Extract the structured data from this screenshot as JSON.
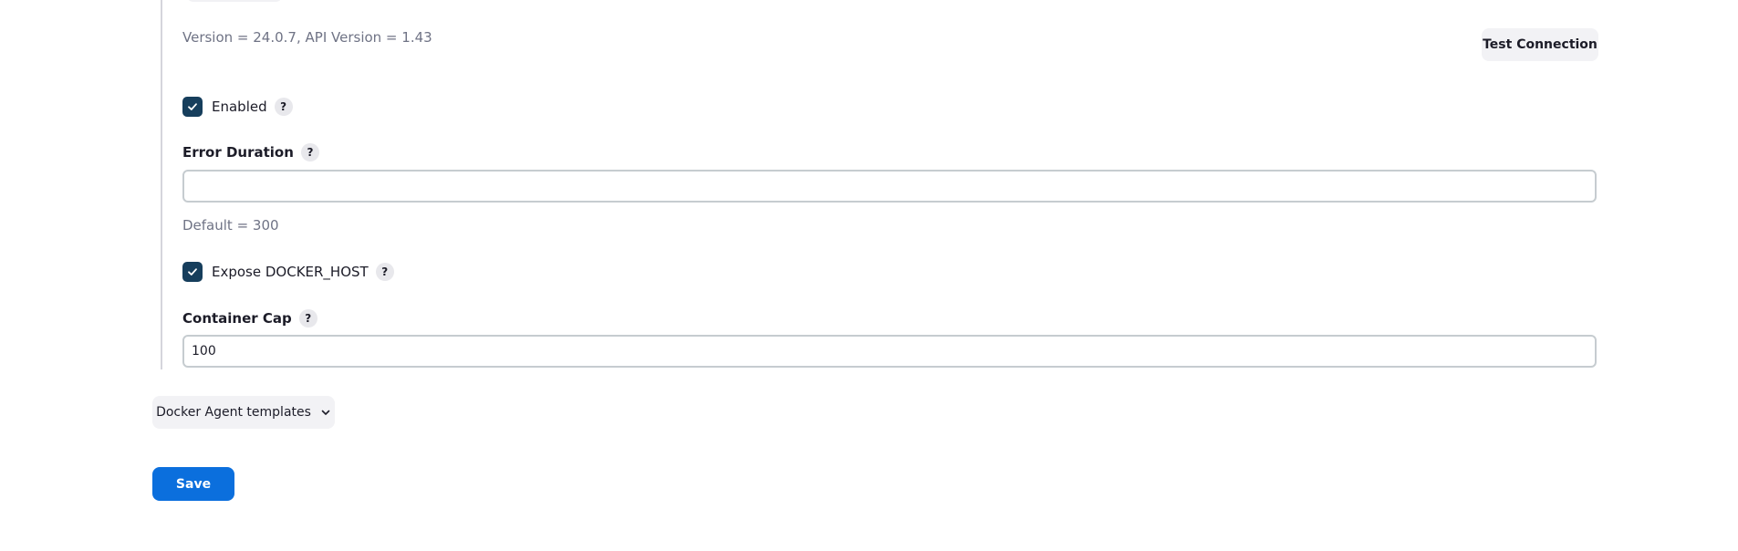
{
  "cloud_config": {
    "version_info": "Version = 24.0.7, API Version = 1.43",
    "test_connection_label": "Test Connection",
    "enabled": {
      "label": "Enabled",
      "checked": true,
      "help": "?"
    },
    "error_duration": {
      "label": "Error Duration",
      "help": "?",
      "value": "",
      "default_hint": "Default = 300"
    },
    "expose_docker_host": {
      "label": "Expose DOCKER_HOST",
      "checked": true,
      "help": "?"
    },
    "container_cap": {
      "label": "Container Cap",
      "help": "?",
      "value": "100"
    }
  },
  "agent_templates": {
    "label": "Docker Agent templates",
    "icon": "chevron-down-icon"
  },
  "actions": {
    "save_label": "Save"
  },
  "colors": {
    "checkbox": "#163e5c",
    "primary_button": "#0b6fdd",
    "secondary_button": "#f2f2f5",
    "muted_text": "#6f7385"
  }
}
